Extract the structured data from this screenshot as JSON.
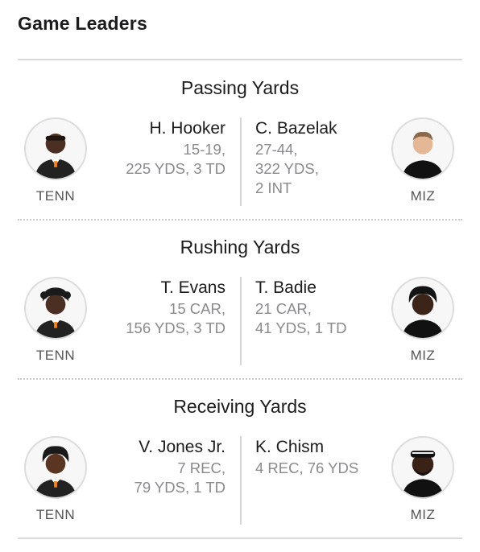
{
  "header": {
    "title": "Game Leaders"
  },
  "sections": [
    {
      "title": "Passing Yards",
      "left": {
        "name": "H. Hooker",
        "stats": [
          "15-19,",
          "225 YDS, 3 TD"
        ],
        "team": "TENN"
      },
      "right": {
        "name": "C. Bazelak",
        "stats": [
          "27-44,",
          "322 YDS,",
          "2 INT"
        ],
        "team": "MIZ"
      }
    },
    {
      "title": "Rushing Yards",
      "left": {
        "name": "T. Evans",
        "stats": [
          "15 CAR,",
          "156 YDS, 3 TD"
        ],
        "team": "TENN"
      },
      "right": {
        "name": "T. Badie",
        "stats": [
          "21 CAR,",
          "41 YDS, 1 TD"
        ],
        "team": "MIZ"
      }
    },
    {
      "title": "Receiving Yards",
      "left": {
        "name": "V. Jones Jr.",
        "stats": [
          "7 REC,",
          "79 YDS, 1 TD"
        ],
        "team": "TENN"
      },
      "right": {
        "name": "K. Chism",
        "stats": [
          "4 REC, 76 YDS"
        ],
        "team": "MIZ"
      }
    }
  ],
  "colors": {
    "divider": "#d9d9d9",
    "secondary_text": "#8a8a8e",
    "tenn_accent": "#ff8200",
    "miz_accent": "#111111"
  }
}
